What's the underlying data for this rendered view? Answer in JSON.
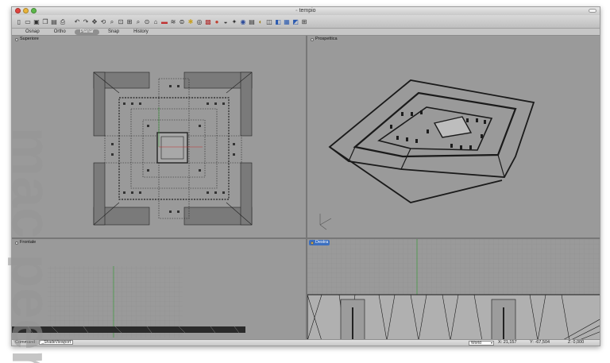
{
  "window": {
    "title": "tempio",
    "traffic_colors": [
      "#e0443e",
      "#e9b43a",
      "#5cb84a"
    ]
  },
  "toolbar": {
    "icons": [
      "new-file-icon",
      "open-folder-icon",
      "save-icon",
      "copy-icon",
      "paste-icon",
      "print-icon",
      "undo-icon",
      "redo-icon",
      "pan-icon",
      "rotate-view-icon",
      "zoom-icon",
      "zoom-window-icon",
      "zoom-extents-icon",
      "zoom-selected-icon",
      "zoom-dynamic-icon",
      "named-view-icon",
      "red-tool-icon",
      "layers-icon",
      "properties-icon",
      "select-icon",
      "osnap-icon",
      "render-icon",
      "sphere-icon",
      "material-icon",
      "light-icon",
      "camera-icon",
      "view-top-icon",
      "view-front-icon",
      "view-right-icon",
      "view-perspective-icon",
      "shade-icon",
      "render-preview-icon",
      "grid-icon"
    ]
  },
  "tabs": [
    {
      "label": "Osnap",
      "active": false
    },
    {
      "label": "Ortho",
      "active": false
    },
    {
      "label": "Planar",
      "active": true
    },
    {
      "label": "Snap",
      "active": false
    },
    {
      "label": "History",
      "active": false
    }
  ],
  "viewports": {
    "top": {
      "label": "Superiore"
    },
    "perspective": {
      "label": "Prospettica"
    },
    "front": {
      "label": "Frontale"
    },
    "right": {
      "label": "Destra",
      "active": true
    }
  },
  "status": {
    "command_label": "Command:",
    "command_value": "_ShadeViewport",
    "units": "World",
    "x": "X: 21,157",
    "y": "Y: -67,504",
    "z": "Z: 0,000"
  },
  "watermark": "mac peer",
  "colors": {
    "viewport_bg": "#9a9a9a",
    "active_label": "#3b6fc0",
    "grid_line": "#8c8c8c",
    "axis_green": "#3a9a3a",
    "axis_red": "#c03030"
  }
}
